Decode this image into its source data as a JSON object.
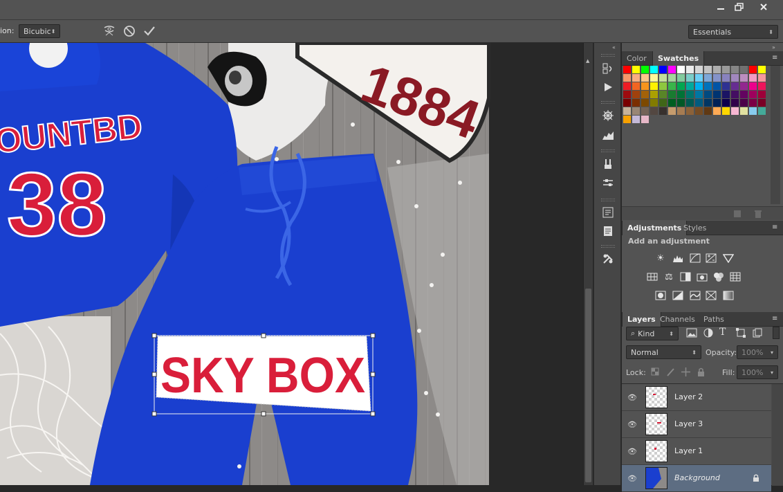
{
  "options_bar": {
    "interpolation_label_partial": "ion:",
    "interpolation_value": "Bicubic",
    "workspace": "Essentials"
  },
  "canvas": {
    "shirt_text_line1": "OUNTBD",
    "shirt_number": "38",
    "plate_number": "1884",
    "transformed_text": "SKY BOX",
    "colors": {
      "royal_blue": "#1a3fcf",
      "red": "#d91e3a",
      "floor_gray": "#8d8a88"
    }
  },
  "color_panel": {
    "tabs": [
      "Color",
      "Swatches"
    ],
    "active_tab": "Swatches"
  },
  "adjustments_panel": {
    "tabs": [
      "Adjustments",
      "Styles"
    ],
    "active_tab": "Adjustments",
    "header": "Add an adjustment",
    "icons": [
      "brightness-contrast-icon",
      "levels-icon",
      "curves-icon",
      "exposure-icon",
      "vibrance-icon",
      "hue-saturation-icon",
      "color-balance-icon",
      "black-white-icon",
      "photo-filter-icon",
      "channel-mixer-icon",
      "color-lookup-icon",
      "invert-icon",
      "posterize-icon",
      "threshold-icon",
      "selective-color-icon",
      "gradient-map-icon"
    ]
  },
  "layers_panel": {
    "tabs": [
      "Layers",
      "Channels",
      "Paths"
    ],
    "active_tab": "Layers",
    "filter_kind": "Kind",
    "blend_mode": "Normal",
    "opacity_label": "Opacity:",
    "opacity_value": "100%",
    "lock_label": "Lock:",
    "fill_label": "Fill:",
    "fill_value": "100%",
    "layers": [
      {
        "name": "Layer 2",
        "selected": false
      },
      {
        "name": "Layer 3",
        "selected": false
      },
      {
        "name": "Layer 1",
        "selected": false
      },
      {
        "name": "Background",
        "selected": true,
        "locked": true
      }
    ]
  },
  "swatches": [
    "#ff0000",
    "#ffff00",
    "#00ff00",
    "#00ffff",
    "#0000ff",
    "#ff00ff",
    "#ffffff",
    "#ebebeb",
    "#d6d6d6",
    "#c2c2c2",
    "#adadad",
    "#999999",
    "#858585",
    "#707070",
    "#ff0000",
    "#ffff00",
    "#f7976a",
    "#f9ad81",
    "#fdc68a",
    "#fff79a",
    "#c4df9b",
    "#a3d39c",
    "#82ca9d",
    "#7bcdc8",
    "#6ecff6",
    "#7ea7d8",
    "#8493ca",
    "#8882be",
    "#a187be",
    "#bc8dbf",
    "#f49ac2",
    "#f6989d",
    "#ed1c24",
    "#f26522",
    "#f7941d",
    "#fff200",
    "#8dc73f",
    "#39b54a",
    "#00a651",
    "#00a99d",
    "#00aeef",
    "#0072bc",
    "#0054a6",
    "#2e3192",
    "#662d91",
    "#92278f",
    "#ec008c",
    "#ed145b",
    "#9e0b0f",
    "#a0410d",
    "#a36209",
    "#aba000",
    "#598527",
    "#197b30",
    "#007236",
    "#00746b",
    "#0076a3",
    "#004a80",
    "#003471",
    "#1b1464",
    "#440e62",
    "#630460",
    "#9e005d",
    "#9e0039",
    "#790000",
    "#7b2e00",
    "#7d4900",
    "#827b00",
    "#406618",
    "#005e20",
    "#005826",
    "#005952",
    "#005b7f",
    "#003663",
    "#002157",
    "#0d004c",
    "#32004b",
    "#4b0049",
    "#7b0046",
    "#7a0026",
    "#c7b299",
    "#998675",
    "#736357",
    "#534741",
    "#37302d",
    "#c69c6d",
    "#a67c52",
    "#8c6239",
    "#754c24",
    "#603913",
    "#ffaa55",
    "#ffd700",
    "#f7b6d2",
    "#e0e0a0",
    "#88ccee",
    "#44aa99",
    "#f8a100",
    "#c4b9d8",
    "#e7b8c8"
  ]
}
